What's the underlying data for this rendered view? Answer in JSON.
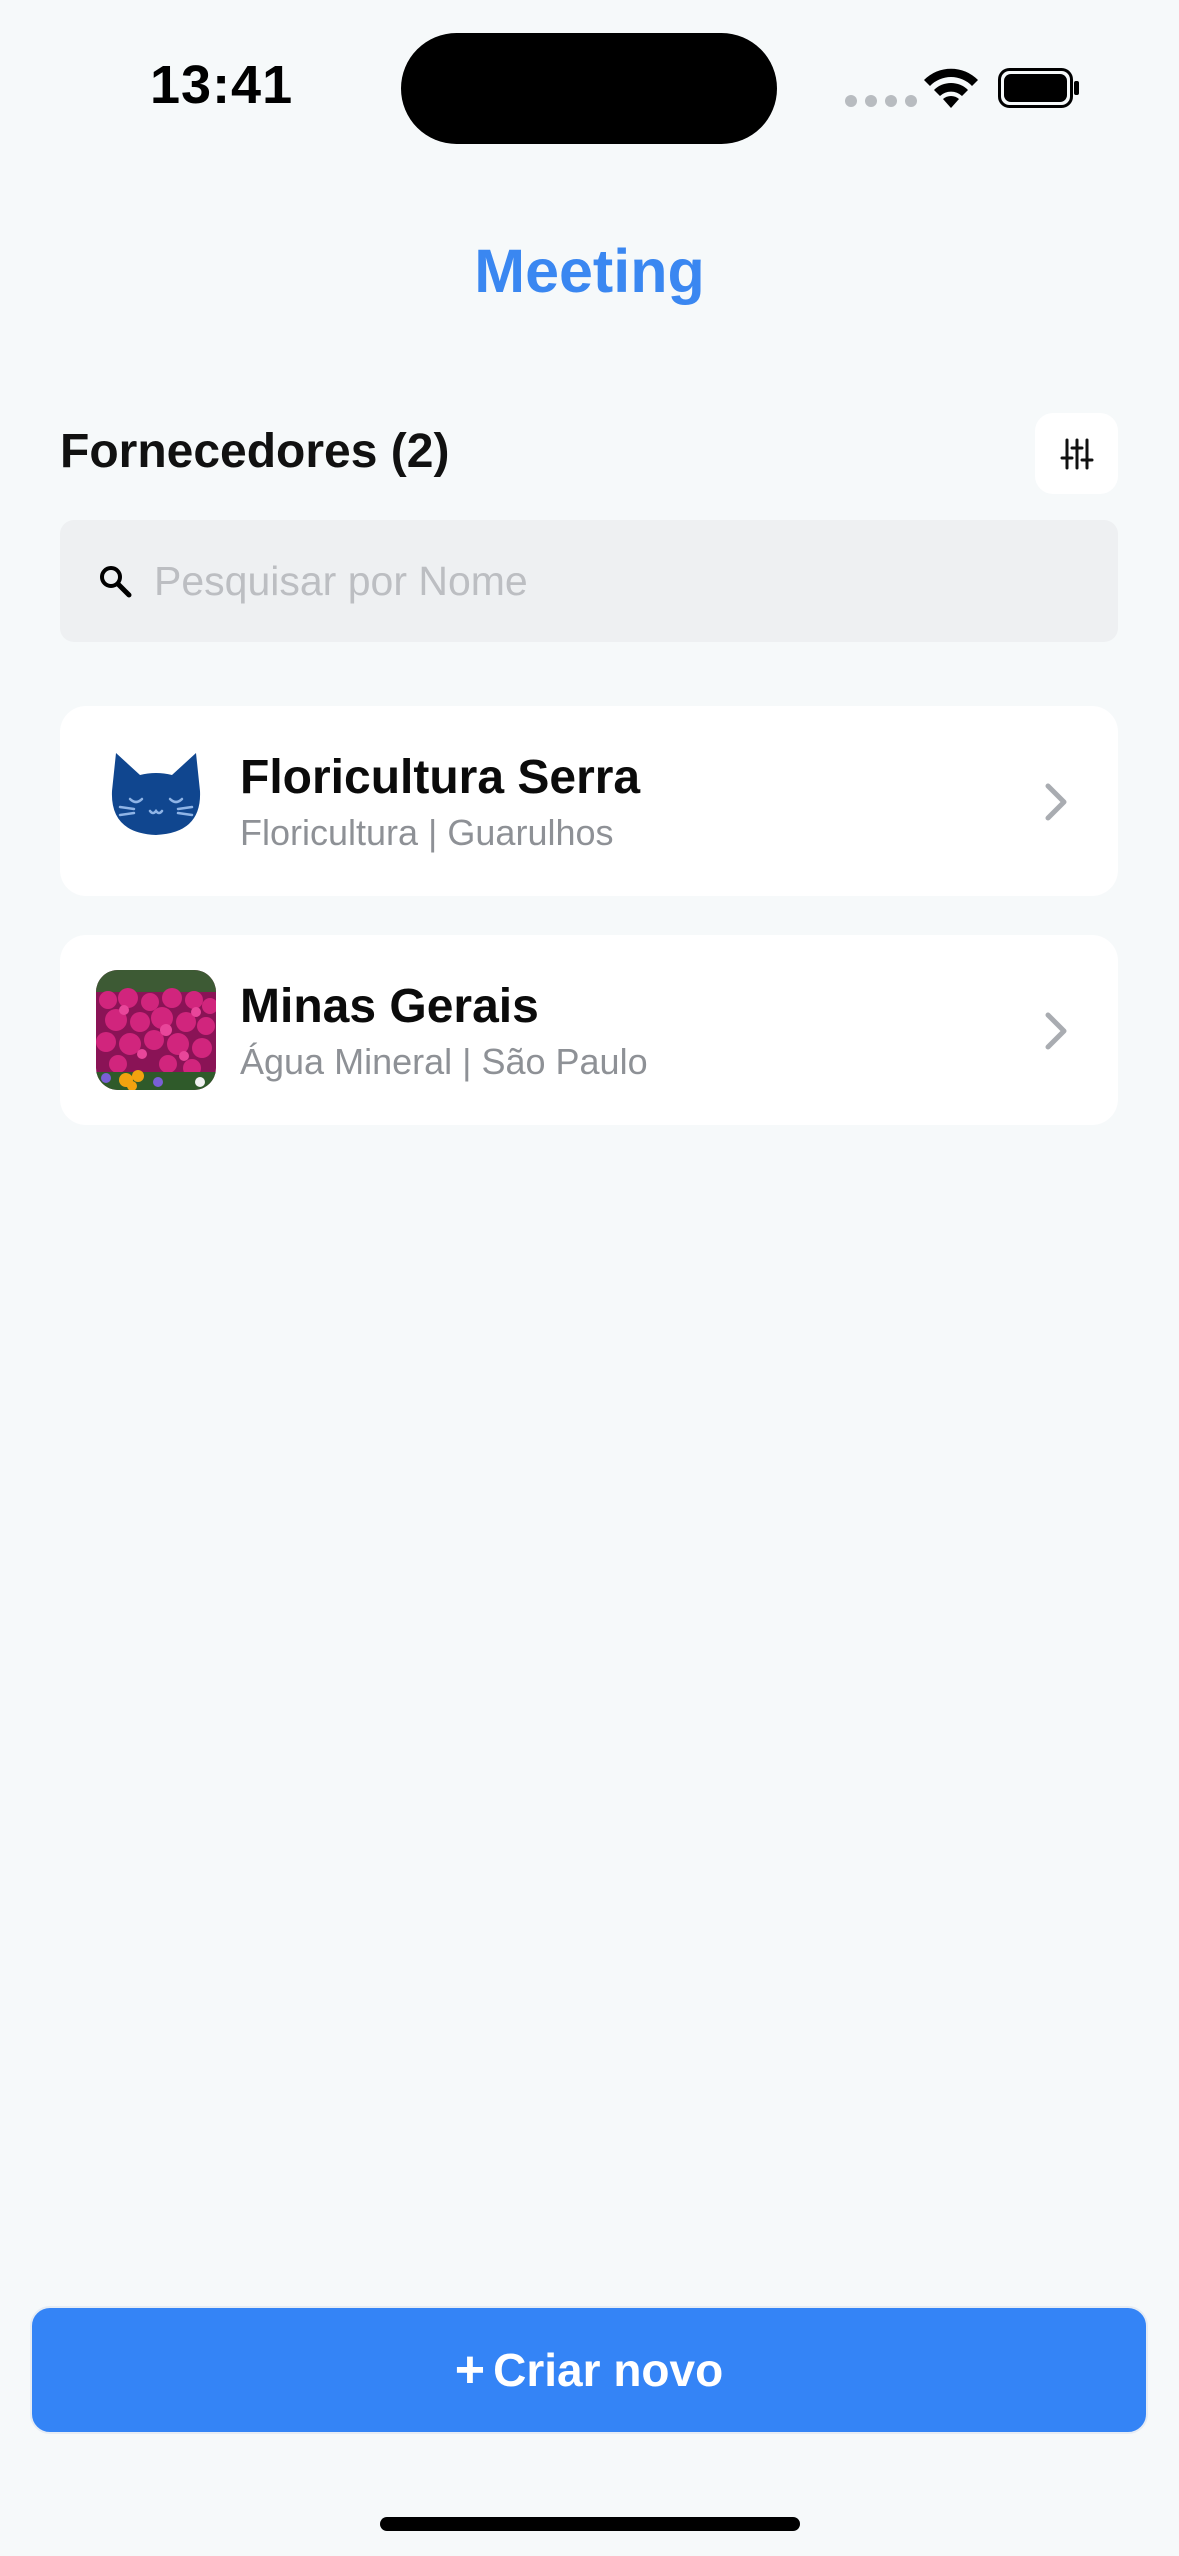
{
  "status_bar": {
    "time": "13:41"
  },
  "header": {
    "title": "Meeting"
  },
  "section": {
    "title": "Fornecedores (2)"
  },
  "search": {
    "placeholder": "Pesquisar por Nome",
    "value": ""
  },
  "suppliers": [
    {
      "name": "Floricultura Serra",
      "subtitle": "Floricultura | Guarulhos",
      "logo": "blue-cat-icon"
    },
    {
      "name": "Minas Gerais",
      "subtitle": "Água Mineral | São Paulo",
      "logo": "flowers-photo"
    }
  ],
  "actions": {
    "create_plus": "+",
    "create_label": "Criar novo"
  },
  "colors": {
    "accent": "#3484f6",
    "title": "#3a87f1",
    "background": "#f6f9fa"
  }
}
